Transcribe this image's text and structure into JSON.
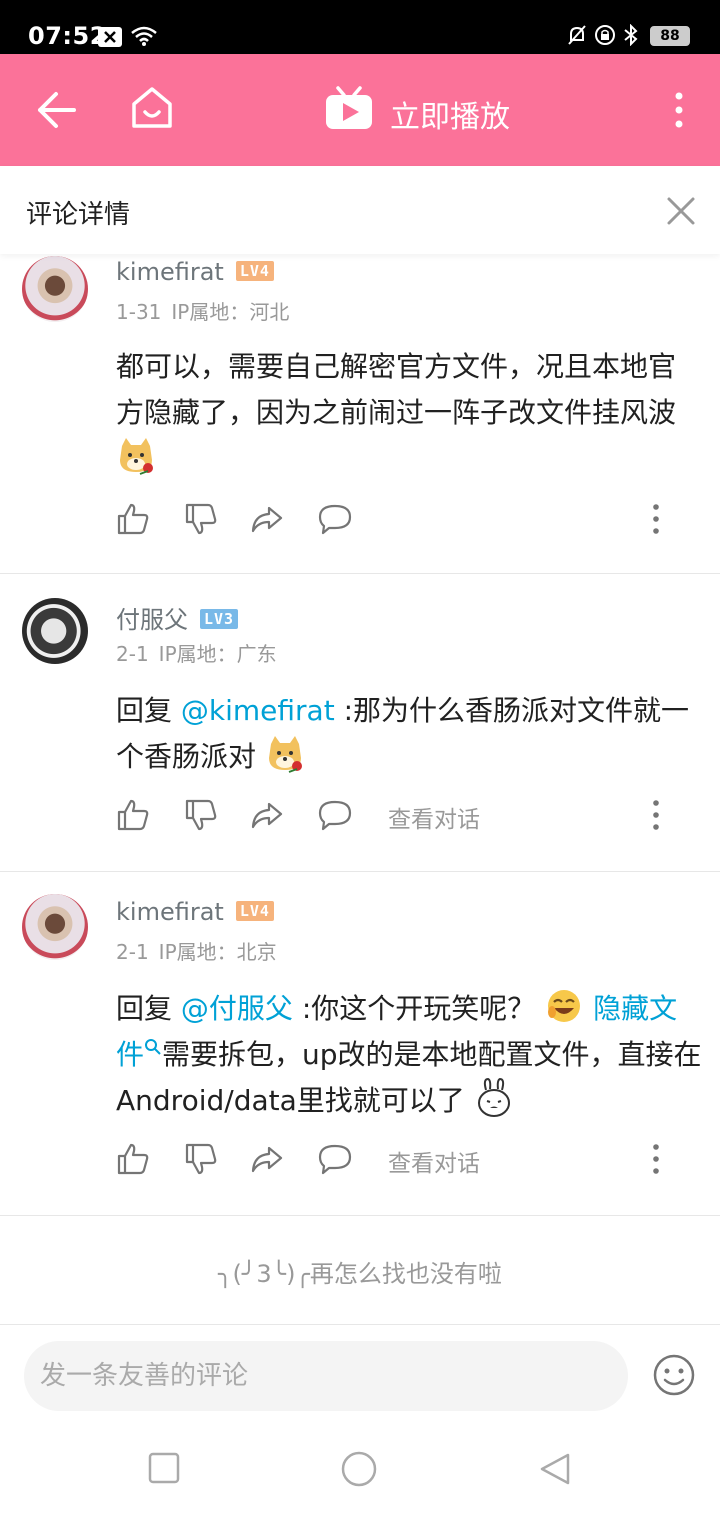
{
  "status_bar": {
    "time": "07:52",
    "battery": "88"
  },
  "title_bar": {
    "title": "立即播放"
  },
  "sub_header": {
    "title": "评论详情"
  },
  "comments": [
    {
      "username": "kimefirat",
      "level": "LV4",
      "date": "1-31",
      "ip": "IP属地：河北",
      "text": "都可以，需要自己解密官方文件，况且本地官方隐藏了，因为之前闹过一阵子改文件挂风波",
      "emoji": "doge-rose-icon"
    },
    {
      "username": "付服父",
      "level": "LV3",
      "date": "2-1",
      "ip": "IP属地：广东",
      "reply_prefix": "回复 ",
      "mention": "@kimefirat",
      "text": " :那为什么香肠派对文件就一个香肠派对",
      "emoji": "doge-rose-icon",
      "view_conversation": "查看对话"
    },
    {
      "username": "kimefirat",
      "level": "LV4",
      "date": "2-1",
      "ip": "IP属地：北京",
      "reply_prefix": "回复 ",
      "mention": "@付服父",
      "text_1": " :你这个开玩笑呢？ ",
      "emoji_1": "laugh-icon",
      "keyword": "隐藏文件",
      "text_2": "需要拆包，up改的是本地配置文件，直接在Android/data里找就可以了",
      "emoji_2": "bunny-icon",
      "view_conversation": "查看对话"
    }
  ],
  "end_message": "╮(╯3╰)╭再怎么找也没有啦",
  "input_bar": {
    "placeholder": "发一条友善的评论"
  },
  "colors": {
    "brand_pink": "#fb7299",
    "link_blue": "#00a1d6",
    "lv4_orange": "#f6b37c",
    "lv3_blue": "#79b9e8"
  }
}
